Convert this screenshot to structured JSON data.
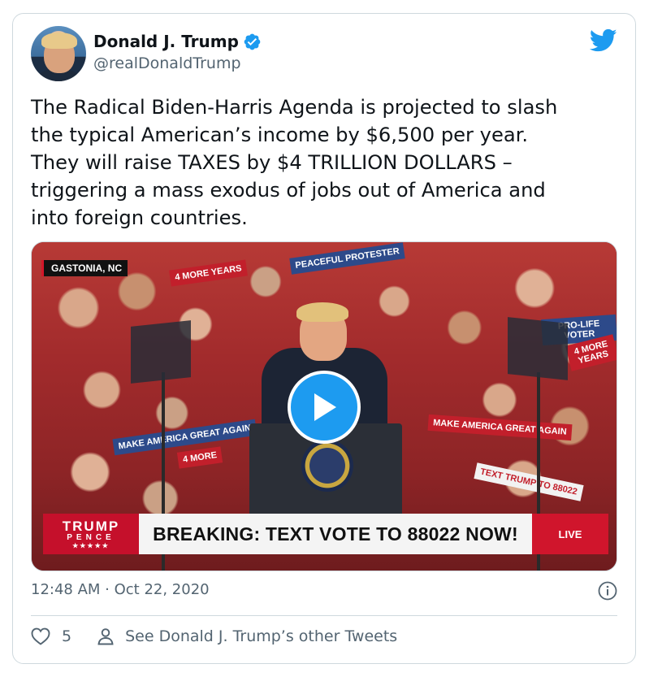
{
  "tweet": {
    "author_name": "Donald J. Trump",
    "handle": "@realDonaldTrump",
    "text": "The Radical Biden-Harris Agenda is projected to slash\nthe typical American’s income by $6,500 per year.\nThey will raise TAXES by $4 TRILLION DOLLARS –\ntriggering a mass exodus of jobs out of America and\ninto foreign countries.",
    "timestamp": "12:48 AM · Oct 22, 2020",
    "like_count": "5",
    "other_tweets_label": "See Donald J. Trump’s other Tweets"
  },
  "video": {
    "location_tag": "GASTONIA, NC",
    "banner_text": "BREAKING: TEXT VOTE TO 88022 NOW!",
    "live_label": "LIVE",
    "logo_line1": "TRUMP",
    "logo_line2": "PENCE",
    "logo_stars": "★★★★★",
    "signs": [
      "4 MORE YEARS",
      "MAKE AMERICA GREAT AGAIN",
      "4 MORE",
      "TEXT TRUMP TO 88022",
      "PEACEFUL PROTESTER",
      "PRO-LIFE VOTER",
      "4 MORE YEARS",
      "MAKE AMERICA GREAT AGAIN"
    ]
  },
  "colors": {
    "twitter_blue": "#1d9bf0",
    "text_primary": "#0f1419",
    "text_secondary": "#536471",
    "border": "#cfd9de"
  },
  "icons": {
    "verified": "verified-badge-icon",
    "brand": "twitter-bird-icon",
    "play": "play-icon",
    "info": "info-icon",
    "like": "heart-icon",
    "profile": "user-icon"
  }
}
